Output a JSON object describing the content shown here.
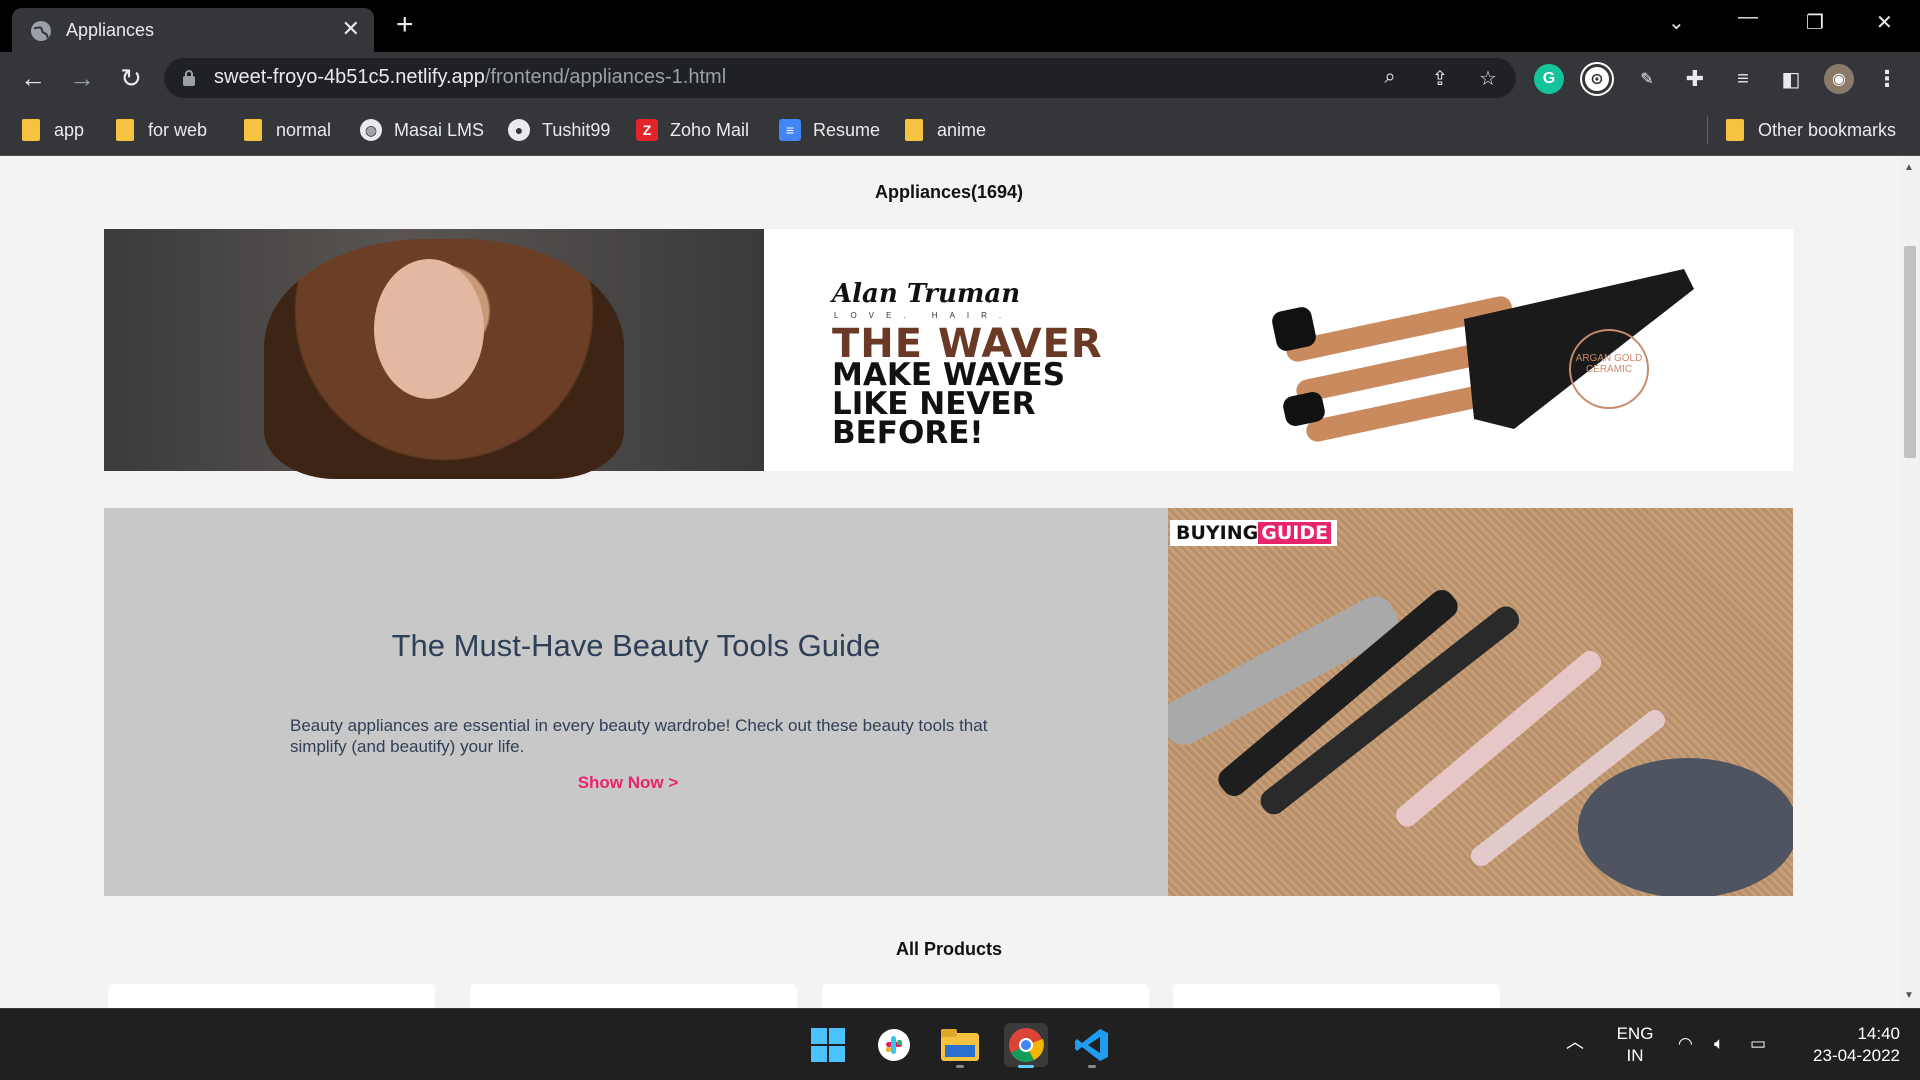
{
  "tab": {
    "title": "Appliances"
  },
  "address": {
    "domain": "sweet-froyo-4b51c5.netlify.app",
    "path": "/frontend/appliances-1.html"
  },
  "bookmarks": [
    {
      "label": "app",
      "icon": "folder-icon"
    },
    {
      "label": "for web",
      "icon": "folder-icon"
    },
    {
      "label": "normal",
      "icon": "folder-icon"
    },
    {
      "label": "Masai LMS",
      "icon": "globe-icon"
    },
    {
      "label": "Tushit99",
      "icon": "github-icon"
    },
    {
      "label": "Zoho Mail",
      "icon": "zoho-icon"
    },
    {
      "label": "Resume",
      "icon": "docs-icon"
    },
    {
      "label": "anime",
      "icon": "folder-icon"
    }
  ],
  "other_bookmarks": "Other bookmarks",
  "page": {
    "heading": "Appliances(1694)",
    "banner": {
      "brand": "Alan Truman",
      "tagline": "LOVE. HAIR.",
      "headline": "THE WAVER",
      "slogan": "MAKE WAVES LIKE NEVER BEFORE!",
      "badge": "ARGAN GOLD CERAMIC"
    },
    "guide": {
      "title": "The Must-Have Beauty Tools Guide",
      "text": "Beauty appliances are essential in every beauty wardrobe! Check out these beauty tools that simplify (and beautify) your life.",
      "cta": "Show Now >",
      "badge_a": "BUYING",
      "badge_b": "GUIDE"
    },
    "all_products": "All Products"
  },
  "taskbar": {
    "lang1": "ENG",
    "lang2": "IN",
    "time": "14:40",
    "date": "23-04-2022"
  },
  "colors": {
    "accent": "#e8246d",
    "guide_bg": "#c8c8c8",
    "chrome": "#35363a"
  }
}
